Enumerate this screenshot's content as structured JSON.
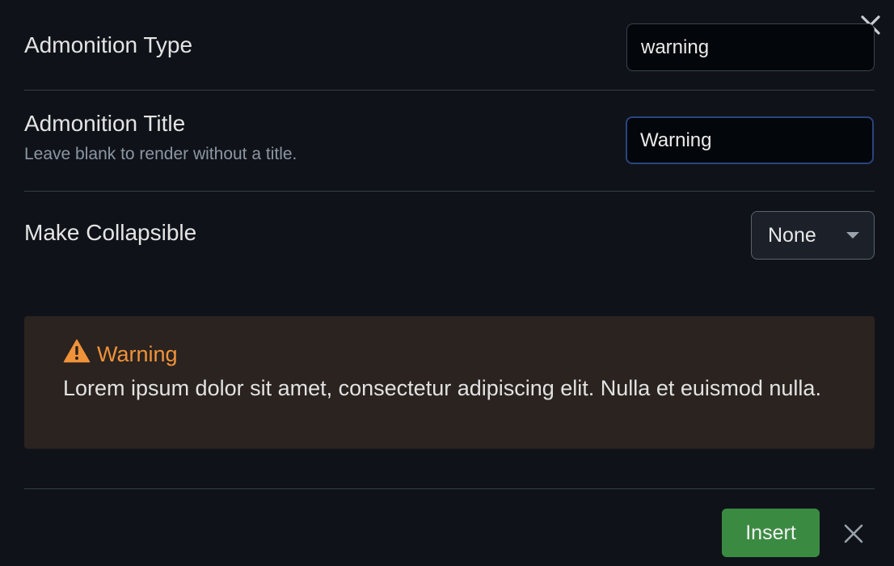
{
  "settings": {
    "type": {
      "name": "Admonition Type",
      "value": "warning"
    },
    "title": {
      "name": "Admonition Title",
      "description": "Leave blank to render without a title.",
      "value": "Warning"
    },
    "collapsible": {
      "name": "Make Collapsible",
      "selected": "None"
    }
  },
  "preview": {
    "icon": "warning-triangle-icon",
    "title": "Warning",
    "body": "Lorem ipsum dolor sit amet, consectetur adipiscing elit. Nulla et euismod nulla."
  },
  "actions": {
    "insert_label": "Insert",
    "close_icon": "close-icon"
  },
  "colors": {
    "background": "#0f1319",
    "warning_accent": "#f0923a",
    "preview_background": "#2a231f",
    "insert_button": "#3b8a42",
    "focus_border": "#2a4480"
  }
}
